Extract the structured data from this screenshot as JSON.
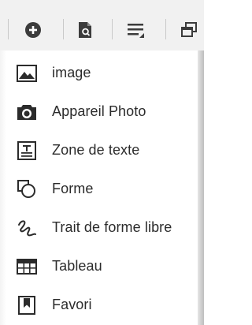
{
  "toolbar": {
    "icons": [
      "add-circle-icon",
      "document-icon",
      "paragraph-align-icon",
      "window-copy-icon"
    ]
  },
  "insert_menu": {
    "items": [
      {
        "label": "image",
        "icon": "image-icon"
      },
      {
        "label": "Appareil Photo",
        "icon": "camera-icon"
      },
      {
        "label": "Zone de texte",
        "icon": "text-box-icon"
      },
      {
        "label": "Forme",
        "icon": "shapes-icon"
      },
      {
        "label": "Trait de forme libre",
        "icon": "freehand-icon"
      },
      {
        "label": "Tableau",
        "icon": "table-icon"
      },
      {
        "label": "Favori",
        "icon": "bookmark-icon"
      }
    ]
  },
  "colors": {
    "toolbar_bg": "#f1f1f1",
    "icon": "#3c3c3c",
    "text": "#2b2b2b"
  }
}
